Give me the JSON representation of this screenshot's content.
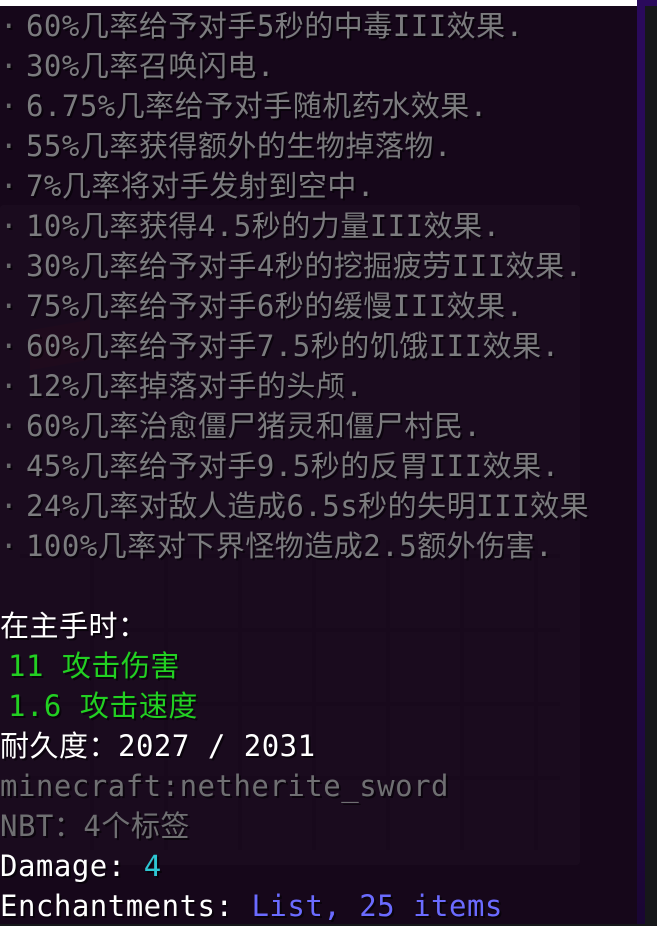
{
  "enchantment_effects": [
    "60%几率给予对手5秒的中毒III效果.",
    "30%几率召唤闪电.",
    "6.75%几率给予对手随机药水效果.",
    "55%几率获得额外的生物掉落物.",
    "7%几率将对手发射到空中.",
    "10%几率获得4.5秒的力量III效果.",
    "30%几率给予对手4秒的挖掘疲劳III效果.",
    "75%几率给予对手6秒的缓慢III效果.",
    "60%几率给予对手7.5秒的饥饿III效果.",
    "12%几率掉落对手的头颅.",
    "60%几率治愈僵尸猪灵和僵尸村民.",
    "45%几率给予对手9.5秒的反胃III效果.",
    "24%几率对敌人造成6.5s秒的失明III效果",
    "100%几率对下界怪物造成2.5额外伤害."
  ],
  "bullet": "·",
  "main_hand": {
    "header": "在主手时：",
    "attack_damage": "11 攻击伤害",
    "attack_speed": "1.6 攻击速度"
  },
  "durability": {
    "label": "耐久度：",
    "value": "2027 / 2031"
  },
  "item_id": "minecraft:netherite_sword",
  "nbt": "NBT：4个标签",
  "damage": {
    "key": "Damage:",
    "value": "4"
  },
  "enchantments": {
    "key": "Enchantments:",
    "value": "List, 25 items"
  },
  "colors": {
    "tooltip_bg": "#16041a",
    "border": "#2a0a5c",
    "enchant_text": "#7b7b7e",
    "attribute_green": "#22d022",
    "damage_cyan": "#2ec6d2",
    "list_blue": "#6b6bff"
  }
}
